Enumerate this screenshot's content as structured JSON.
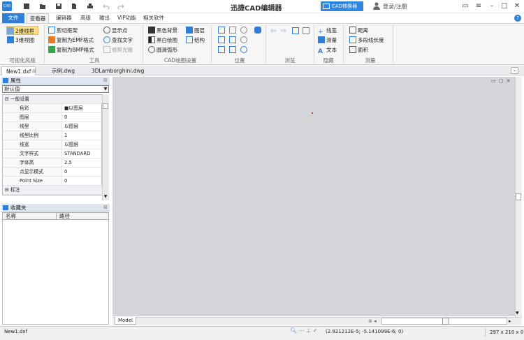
{
  "app": {
    "logo_text": "CAD",
    "title": "迅捷CAD编辑器"
  },
  "titlebar": {
    "converter_label": "CAD转换器",
    "login_label": "登录/注册"
  },
  "menu": {
    "file": "文件",
    "tabs": [
      "查看器",
      "编辑器",
      "高级",
      "输出",
      "VIP功能",
      "相关软件"
    ]
  },
  "ribbon": {
    "style": {
      "view2d": "2维线框",
      "view3d": "3维视图",
      "label": "可视化风格"
    },
    "tools": {
      "crop": "剪切框架",
      "emf": "复制为EMF格式",
      "bmp": "复制为BMP格式",
      "points": "显示点",
      "find": "查找文字",
      "trim": "修剪光栅",
      "label": "工具"
    },
    "cad_settings": {
      "black_bg": "黑色背景",
      "bw": "黑白绘图",
      "smooth": "圆滑弧形",
      "layers": "图层",
      "structure": "结构",
      "label": "CAD绘图设置"
    },
    "position": {
      "label": "位置"
    },
    "browse": {
      "label": "浏览"
    },
    "hide": {
      "line_width": "线宽",
      "measure": "测量",
      "text": "文本",
      "label": "隐藏"
    },
    "measure": {
      "distance": "距离",
      "polyline": "多段线长度",
      "area": "面积",
      "label": "测量"
    }
  },
  "doc_tabs": [
    "New1.dxf",
    "示例.dwg",
    "3DLamborghini.dwg"
  ],
  "properties": {
    "title": "属性",
    "selector": "默认值",
    "rows": [
      {
        "key": "一般设置",
        "value": "",
        "category": true
      },
      {
        "key": "色彩",
        "value": "■以图层"
      },
      {
        "key": "图层",
        "value": "0"
      },
      {
        "key": "线型",
        "value": "以图层"
      },
      {
        "key": "线型比例",
        "value": "1"
      },
      {
        "key": "线宽",
        "value": "以图层"
      },
      {
        "key": "文字样式",
        "value": "STANDARD"
      },
      {
        "key": "字体高",
        "value": "2.5"
      },
      {
        "key": "点显示模式",
        "value": "0"
      },
      {
        "key": "Point Size",
        "value": "0"
      },
      {
        "key": "标注",
        "value": "",
        "category": true
      }
    ]
  },
  "favorites": {
    "title": "收藏夹",
    "col_name": "名称",
    "col_path": "路径"
  },
  "canvas": {
    "model_tab": "Model"
  },
  "status": {
    "file": "New1.dxf",
    "coords": "(2.921212E-5; -5.141099E-6; 0)",
    "size": "297 x 210 x 0"
  },
  "colors": {
    "accent": "#2f7fd6",
    "canvas_bg": "#d4d5d8",
    "selected": "#ffe08a"
  }
}
